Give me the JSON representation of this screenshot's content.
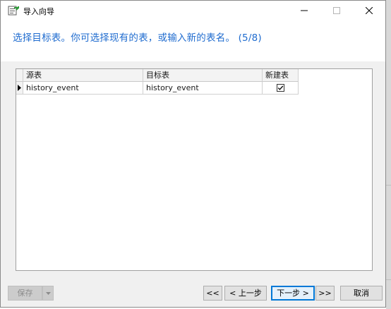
{
  "window": {
    "title": "导入向导",
    "icon": "import-wizard-icon"
  },
  "header": {
    "instruction": "选择目标表。你可选择现有的表，或输入新的表名。 (5/8)"
  },
  "table": {
    "columns": [
      "源表",
      "目标表",
      "新建表"
    ],
    "rows": [
      {
        "source": "history_event",
        "target": "history_event",
        "create_new": true
      }
    ]
  },
  "footer": {
    "save_label": "保存",
    "first_label": "<<",
    "prev_label": "< 上一步",
    "next_label": "下一步 >",
    "last_label": ">>",
    "cancel_label": "取消"
  },
  "colors": {
    "accent": "#1e6bcf",
    "focus": "#0078d7"
  }
}
